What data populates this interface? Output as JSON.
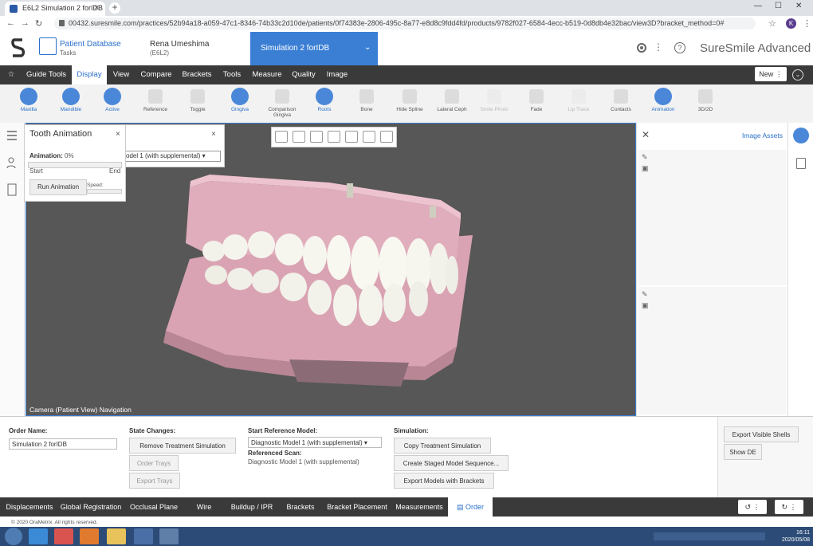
{
  "browser": {
    "tab_title": "E6L2 Simulation 2 forIDB",
    "url": "00432.suresmile.com/practices/52b94a18-a059-47c1-8346-74b33c2d10de/patients/0f74383e-2806-495c-8a77-e8d8c9fdd4fd/products/9782f027-6584-4ecc-b519-0d8db4e32bac/view3D?bracket_method=0#",
    "avatar_letter": "K"
  },
  "header": {
    "patient_db_title": "Patient Database",
    "patient_db_sub": "Tasks",
    "patient_name": "Rena Umeshima",
    "patient_id": "(E6L2)",
    "sim_tab": "Simulation 2 forIDB",
    "brand": "SureSmile Advanced"
  },
  "menu": {
    "items": [
      "Guide Tools",
      "Display",
      "View",
      "Compare",
      "Brackets",
      "Tools",
      "Measure",
      "Quality",
      "Image"
    ],
    "new_label": "New"
  },
  "toolbar": {
    "tools": [
      "Maxilla",
      "Mandible",
      "Active",
      "Reference",
      "Toggle",
      "Gingiva",
      "Comparison Gingiva",
      "Roots",
      "Bone",
      "Hide Spline",
      "Lateral Ceph",
      "Smile Photo",
      "Fade",
      "Lip Trace",
      "Contacts",
      "Animation",
      "3D/2D"
    ]
  },
  "viewport": {
    "camera_text": "Camera (Patient View) Navigation"
  },
  "anim_panel": {
    "title": "Tooth Animation",
    "label": "Animation:",
    "value": "0%",
    "progress": 0,
    "start": "Start",
    "end": "End",
    "run": "Run Animation",
    "speed": "Speed:"
  },
  "model_panel": {
    "select_value": "odel 1 (with supplemental)"
  },
  "right_panel": {
    "title": "Image Assets"
  },
  "bottom": {
    "order_name_label": "Order Name:",
    "order_name_value": "Simulation 2 forIDB",
    "state_label": "State Changes:",
    "remove_btn": "Remove Treatment Simulation",
    "order_trays": "Order Trays",
    "export_trays": "Export Trays",
    "start_ref_label": "Start Reference Model:",
    "start_ref_value": "Diagnostic Model 1 (with supplemental)",
    "ref_scan_label": "Referenced Scan:",
    "ref_scan_value": "Diagnostic Model 1 (with supplemental)",
    "sim_label": "Simulation:",
    "copy_btn": "Copy Treatment Simulation",
    "staged_btn": "Create Staged Model Sequence...",
    "export_models_btn": "Export Models with Brackets",
    "export_shells_btn": "Export Visible Shells",
    "show_de_btn": "Show DE"
  },
  "bottom_tabs": [
    "Displacements",
    "Global Registration",
    "Occlusal Plane",
    "Wire",
    "Buildup / IPR",
    "Brackets",
    "Bracket Placement",
    "Measurements",
    "Order"
  ],
  "footer": {
    "copyright": "© 2020 OraMetrix. All rights reserved."
  },
  "taskbar": {
    "time": "16:11",
    "date": "2020/05/08"
  }
}
